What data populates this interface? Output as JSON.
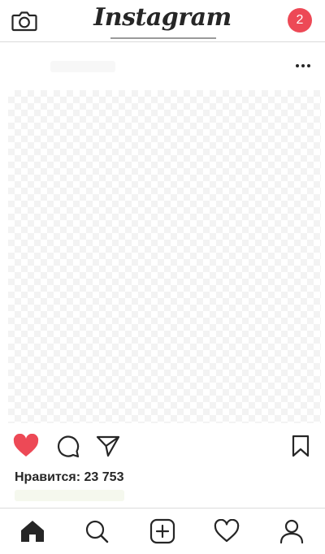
{
  "header": {
    "logo_text": "Instagram",
    "notification_count": "2",
    "camera_icon": "camera-icon"
  },
  "post": {
    "more_icon": "more-horizontal-icon",
    "liked": true,
    "likes_text": "Нравится: 23 753"
  },
  "actions": {
    "like_icon": "heart-filled-icon",
    "comment_icon": "comment-icon",
    "share_icon": "paper-plane-icon",
    "save_icon": "bookmark-icon"
  },
  "tabs": [
    {
      "name": "home",
      "icon": "home-icon",
      "active": true
    },
    {
      "name": "search",
      "icon": "search-icon",
      "active": false
    },
    {
      "name": "add",
      "icon": "add-post-icon",
      "active": false
    },
    {
      "name": "activity",
      "icon": "heart-outline-icon",
      "active": false
    },
    {
      "name": "profile",
      "icon": "profile-icon",
      "active": false
    }
  ],
  "colors": {
    "like_red": "#ed4956",
    "badge_red": "#ed4956",
    "text": "#262626",
    "divider": "#dbdbdb"
  }
}
